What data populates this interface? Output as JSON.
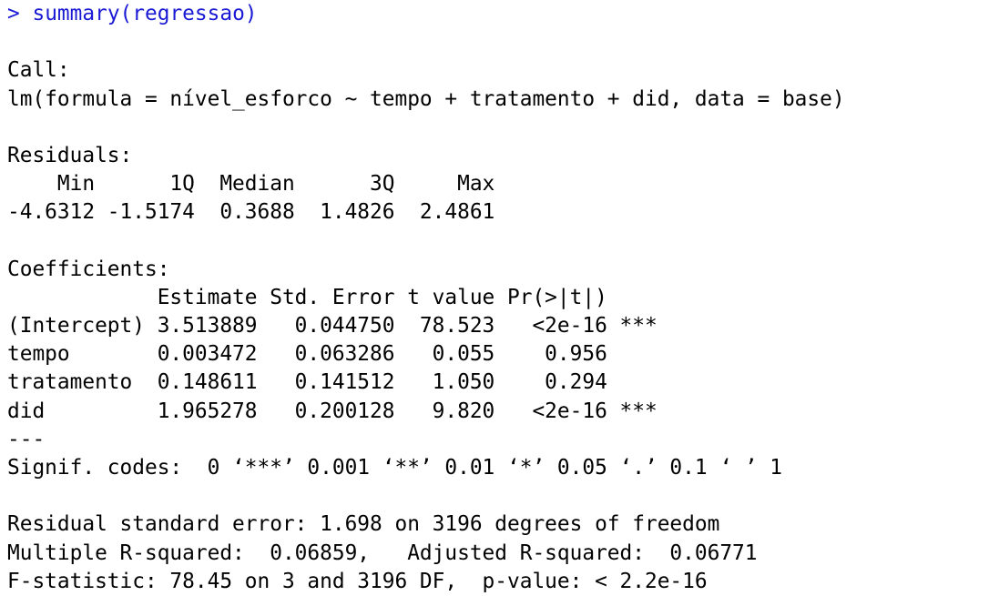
{
  "command": {
    "prompt": ">",
    "text": "summary(regressao)"
  },
  "call": {
    "label": "Call:",
    "formula": "lm(formula = nível_esforco ~ tempo + tratamento + did, data = base)"
  },
  "residuals": {
    "label": "Residuals:",
    "header": "    Min      1Q  Median      3Q     Max ",
    "values": "-4.6312 -1.5174  0.3688  1.4826  2.4861 "
  },
  "coefficients": {
    "label": "Coefficients:",
    "header": "            Estimate Std. Error t value Pr(>|t|)    ",
    "rows": [
      "(Intercept) 3.513889   0.044750  78.523   <2e-16 ***",
      "tempo       0.003472   0.063286   0.055    0.956    ",
      "tratamento  0.148611   0.141512   1.050    0.294    ",
      "did         1.965278   0.200128   9.820   <2e-16 ***"
    ],
    "separator": "---",
    "signif": "Signif. codes:  0 ‘***’ 0.001 ‘**’ 0.01 ‘*’ 0.05 ‘.’ 0.1 ‘ ’ 1"
  },
  "fit": {
    "rse": "Residual standard error: 1.698 on 3196 degrees of freedom",
    "rsq": "Multiple R-squared:  0.06859,\tAdjusted R-squared:  0.06771 ",
    "fstat": "F-statistic: 78.45 on 3 and 3196 DF,  p-value: < 2.2e-16"
  },
  "colors": {
    "command": "#1a1ad4",
    "output": "#000000",
    "background": "#ffffff"
  }
}
